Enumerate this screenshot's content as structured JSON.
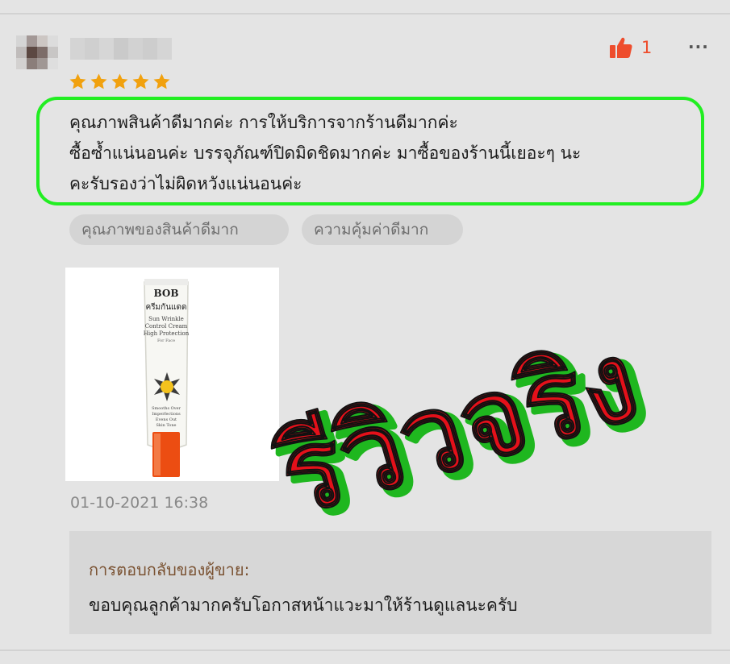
{
  "review": {
    "rating": 5,
    "rating_max": 5,
    "like_count": "1",
    "more_label": "···",
    "text_lines": [
      "คุณภาพสินค้าดีมากค่ะ  การให้บริการจากร้านดีมากค่ะ",
      "ซื้อซ้ำแน่นอนค่ะ บรรจุภัณฑ์ปิดมิดชิดมากค่ะ มาซื้อของร้านนี้เยอะๆ นะ",
      "คะรับรองว่าไม่ผิดหวังแน่นอนค่ะ"
    ],
    "tags": [
      "คุณภาพของสินค้าดีมาก",
      "ความคุ้มค่าดีมาก"
    ],
    "timestamp": "01-10-2021 16:38",
    "overlay_text": "รีวิวจริง"
  },
  "product_photo": {
    "brand": "BOB",
    "thai_name": "ครีมกันแดด",
    "en_lines": [
      "Sun Wrinkle",
      "Control Cream",
      "High Protection",
      "For Face"
    ],
    "small_lines": [
      "Smooths Over",
      "Imperfections",
      "Evens Out",
      "Skin Tone"
    ]
  },
  "seller_reply": {
    "label": "การตอบกลับของผู้ขาย:",
    "text": "ขอบคุณลูกค้ามากครับโอกาสหน้าแวะมาให้ร้านดูแลนะครับ"
  },
  "colors": {
    "accent": "#ee4d2d",
    "star": "#f1a10e",
    "highlight_border": "#22ee22",
    "overlay_red": "#e4101a",
    "overlay_shadow": "#1fb71f"
  },
  "icons": {
    "like": "thumbs-up-icon",
    "more": "ellipsis-icon",
    "star": "star-icon"
  }
}
